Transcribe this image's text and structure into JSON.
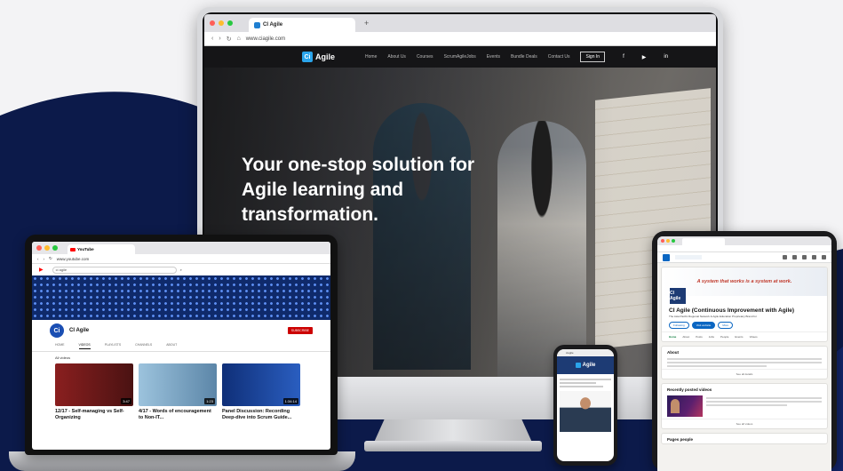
{
  "imac": {
    "tab_title": "CI Agile",
    "new_tab": "+",
    "url": "www.ciagile.com",
    "nav": {
      "logo_text": "Agile",
      "items": [
        "Home",
        "About Us",
        "Courses",
        "ScrumAgileJobs",
        "Events",
        "Bundle Deals",
        "Contact Us"
      ],
      "signin": "Sign In"
    },
    "hero_title": "Your one-stop solution for Agile learning and transformation."
  },
  "laptop": {
    "tab_title": "YouTube",
    "url": "www.youtube.com",
    "search": "ci agile",
    "channel_name": "CI Agile",
    "subscribe": "SUBSCRIBE",
    "tabs": [
      "HOME",
      "VIDEOS",
      "PLAYLISTS",
      "CHANNELS",
      "ABOUT"
    ],
    "filter": "All videos",
    "videos": [
      {
        "title": "12/17 - Self-managing vs Self-Organizing",
        "duration": "3:47",
        "color": "#6e1d1d"
      },
      {
        "title": "4/17 - Words of encouragement to Non-IT...",
        "duration": "1:23",
        "color": "#7aa6c8"
      },
      {
        "title": "Panel Discussion: Recording Deep-dive into Scrum Guide...",
        "duration": "1:34:14",
        "color": "#123a86"
      }
    ]
  },
  "phone": {
    "url": "ciagile",
    "logo_text": "Agile"
  },
  "tablet": {
    "cover_title": "A system that works is a system at work.",
    "logo_text": "CI Agile",
    "name": "CI Agile (Continuous Improvement with Agile)",
    "desc": "The Asia Pacific Regional Network & Agile Education Proprietary Brand for",
    "buttons": [
      "Following",
      "Visit website",
      "More"
    ],
    "tabs": [
      "Home",
      "About",
      "Posts",
      "Jobs",
      "People",
      "Events",
      "Videos"
    ],
    "about_title": "About",
    "see_all": "See all details",
    "updates_title": "Recently posted videos",
    "see_all_posts": "See all videos",
    "pages_title": "Pages people"
  },
  "colors": {
    "navy": "#0c1a4a",
    "accent": "#2aa4ea",
    "youtube_red": "#cc0000",
    "linkedin_blue": "#0a66c2"
  }
}
